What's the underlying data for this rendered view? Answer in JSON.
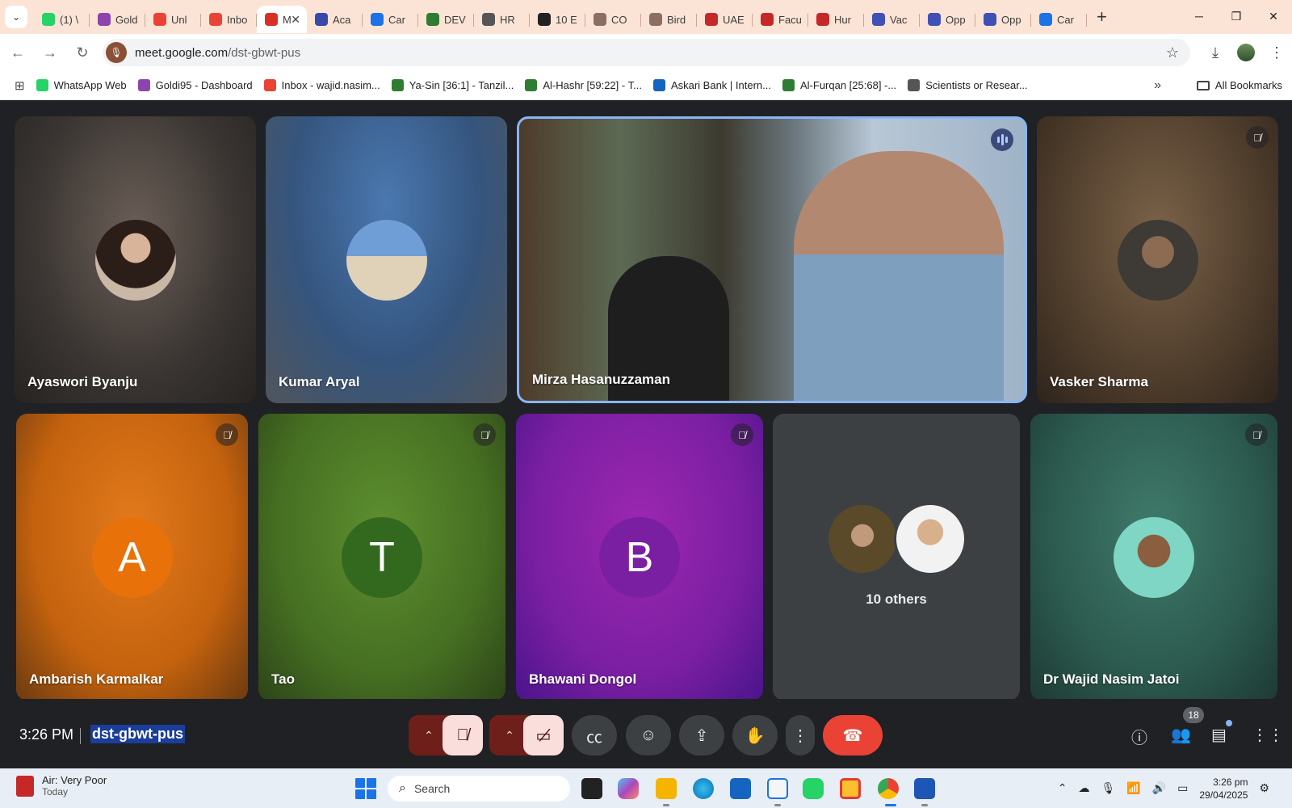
{
  "browser": {
    "tabs": [
      {
        "label": "(1) \\",
        "color": "#25d366"
      },
      {
        "label": "Gold",
        "color": "#8e44ad"
      },
      {
        "label": "Unl",
        "color": "#ea4335"
      },
      {
        "label": "Inbo",
        "color": "#ea4335"
      },
      {
        "label": "M",
        "color": "#d93025",
        "active": true
      },
      {
        "label": "Aca",
        "color": "#3949ab"
      },
      {
        "label": "Car",
        "color": "#1a73e8"
      },
      {
        "label": "DEV",
        "color": "#2e7d32"
      },
      {
        "label": "HR",
        "color": "#555555"
      },
      {
        "label": "10 E",
        "color": "#222222"
      },
      {
        "label": "CO",
        "color": "#8d6e63"
      },
      {
        "label": "Bird",
        "color": "#8d6e63"
      },
      {
        "label": "UAE",
        "color": "#c62828"
      },
      {
        "label": "Facu",
        "color": "#c62828"
      },
      {
        "label": "Hur",
        "color": "#c62828"
      },
      {
        "label": "Vac",
        "color": "#3f51b5"
      },
      {
        "label": "Opp",
        "color": "#3f51b5"
      },
      {
        "label": "Opp",
        "color": "#3f51b5"
      },
      {
        "label": "Car",
        "color": "#1a73e8"
      }
    ],
    "url_host": "meet.google.com",
    "url_path": "/dst-gbwt-pus",
    "bookmarks": [
      {
        "label": "WhatsApp Web",
        "color": "#25d366"
      },
      {
        "label": "Goldi95 - Dashboard",
        "color": "#8e44ad"
      },
      {
        "label": "Inbox - wajid.nasim...",
        "color": "#ea4335"
      },
      {
        "label": "Ya-Sin [36:1] - Tanzil...",
        "color": "#2e7d32"
      },
      {
        "label": "Al-Hashr [59:22] - T...",
        "color": "#2e7d32"
      },
      {
        "label": "Askari Bank | Intern...",
        "color": "#1565c0"
      },
      {
        "label": "Al-Furqan [25:68] -...",
        "color": "#2e7d32"
      },
      {
        "label": "Scientists or Resear...",
        "color": "#555555"
      }
    ],
    "all_bookmarks": "All Bookmarks"
  },
  "meet": {
    "participants": [
      {
        "name": "Ayaswori Byanju",
        "type": "photo"
      },
      {
        "name": "Kumar Aryal",
        "type": "photo"
      },
      {
        "name": "Mirza Hasanuzzaman",
        "type": "video",
        "speaking": true
      },
      {
        "name": "Vasker Sharma",
        "type": "photo",
        "muted": true
      },
      {
        "name": "Ambarish Karmalkar",
        "type": "letter",
        "letter": "A",
        "color": "#e8710a",
        "muted": true
      },
      {
        "name": "Tao",
        "type": "letter",
        "letter": "T",
        "color": "#33691e",
        "muted": true
      },
      {
        "name": "Bhawani Dongol",
        "type": "letter",
        "letter": "B",
        "color": "#7b1fa2",
        "muted": true
      },
      {
        "name": "Dr Wajid Nasim Jatoi",
        "type": "photo",
        "muted": true
      }
    ],
    "others_label": "10 others",
    "time": "3:26 PM",
    "meeting_code": "dst-gbwt-pus",
    "participant_count": "18"
  },
  "taskbar": {
    "weather_title": "Air: Very Poor",
    "weather_sub": "Today",
    "search_placeholder": "Search",
    "time": "3:26 pm",
    "date": "29/04/2025"
  }
}
